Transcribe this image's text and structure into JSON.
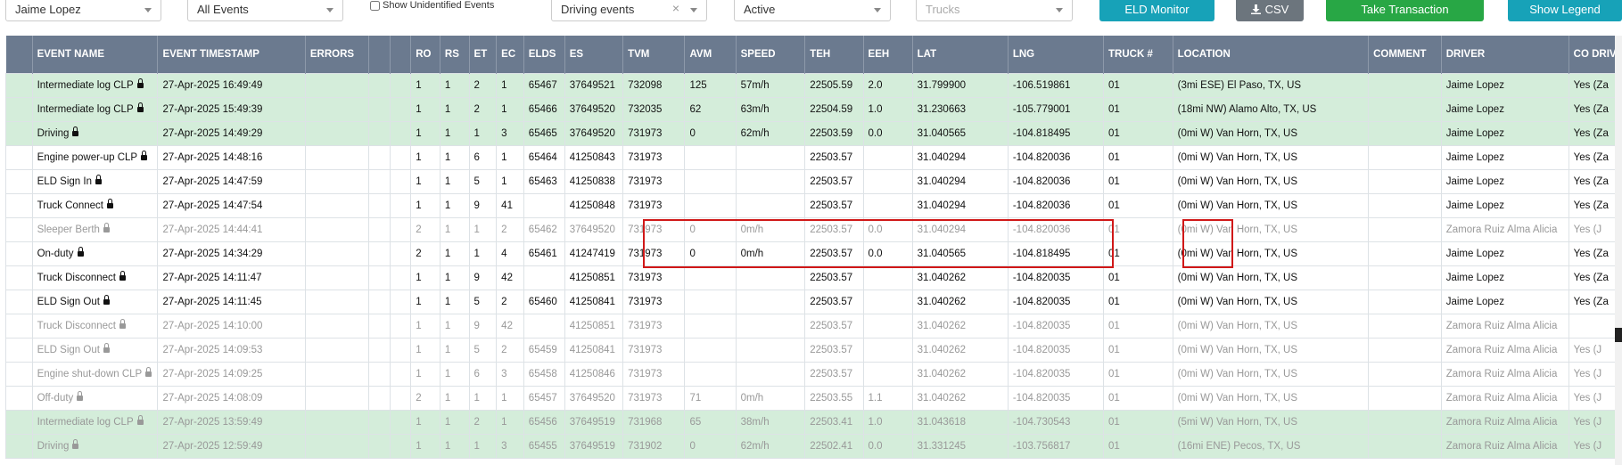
{
  "toolbar": {
    "driver_select": "Jaime Lopez",
    "events_select": "All Events",
    "show_unidentified_label": "Show Unidentified Events",
    "type_select": "Driving events",
    "type_clear": "×",
    "status_select": "Active",
    "trucks_placeholder": "Trucks",
    "eld_monitor": "ELD Monitor",
    "csv": "CSV",
    "csv_icon": "download-icon",
    "take_transaction": "Take Transaction",
    "show_legend": "Show Legend"
  },
  "colors": {
    "header": "#6b7a8f",
    "green_row": "#d4edda",
    "highlight": "#d01818",
    "btn_info": "#17a2b8",
    "btn_green": "#28a745",
    "btn_gray": "#6c757d"
  },
  "table": {
    "columns": [
      "",
      "EVENT NAME",
      "EVENT TIMESTAMP",
      "ERRORS",
      "",
      "",
      "RO",
      "RS",
      "ET",
      "EC",
      "ELDS",
      "ES",
      "TVM",
      "AVM",
      "SPEED",
      "TEH",
      "EEH",
      "LAT",
      "LNG",
      "TRUCK #",
      "LOCATION",
      "COMMENT",
      "DRIVER",
      "CO DRIV"
    ],
    "rows": [
      {
        "style": "green",
        "cells": [
          "",
          "Intermediate log CLP",
          "27-Apr-2025 16:49:49",
          "",
          "",
          "",
          "1",
          "1",
          "2",
          "1",
          "65467",
          "37649521",
          "732098",
          "125",
          "57m/h",
          "22505.59",
          "2.0",
          "31.799900",
          "-106.519861",
          "01",
          "(3mi ESE) El Paso, TX, US",
          "",
          "Jaime Lopez",
          "Yes (Za"
        ]
      },
      {
        "style": "green",
        "cells": [
          "",
          "Intermediate log CLP",
          "27-Apr-2025 15:49:39",
          "",
          "",
          "",
          "1",
          "1",
          "2",
          "1",
          "65466",
          "37649520",
          "732035",
          "62",
          "63m/h",
          "22504.59",
          "1.0",
          "31.230663",
          "-105.779001",
          "01",
          "(18mi NW) Alamo Alto, TX, US",
          "",
          "Jaime Lopez",
          "Yes (Za"
        ]
      },
      {
        "style": "green",
        "cells": [
          "",
          "Driving",
          "27-Apr-2025 14:49:29",
          "",
          "",
          "",
          "1",
          "1",
          "1",
          "3",
          "65465",
          "37649520",
          "731973",
          "0",
          "62m/h",
          "22503.59",
          "0.0",
          "31.040565",
          "-104.818495",
          "01",
          "(0mi W) Van Horn, TX, US",
          "",
          "Jaime Lopez",
          "Yes (Za"
        ]
      },
      {
        "style": "normal",
        "cells": [
          "",
          "Engine power-up CLP",
          "27-Apr-2025 14:48:16",
          "",
          "",
          "",
          "1",
          "1",
          "6",
          "1",
          "65464",
          "41250843",
          "731973",
          "",
          "",
          "22503.57",
          "",
          "31.040294",
          "-104.820036",
          "01",
          "(0mi W) Van Horn, TX, US",
          "",
          "Jaime Lopez",
          "Yes (Za"
        ]
      },
      {
        "style": "normal",
        "cells": [
          "",
          "ELD Sign In",
          "27-Apr-2025 14:47:59",
          "",
          "",
          "",
          "1",
          "1",
          "5",
          "1",
          "65463",
          "41250838",
          "731973",
          "",
          "",
          "22503.57",
          "",
          "31.040294",
          "-104.820036",
          "01",
          "(0mi W) Van Horn, TX, US",
          "",
          "Jaime Lopez",
          "Yes (Za"
        ]
      },
      {
        "style": "normal",
        "cells": [
          "",
          "Truck Connect",
          "27-Apr-2025 14:47:54",
          "",
          "",
          "",
          "1",
          "1",
          "9",
          "41",
          "",
          "41250848",
          "731973",
          "",
          "",
          "22503.57",
          "",
          "31.040294",
          "-104.820036",
          "01",
          "(0mi W) Van Horn, TX, US",
          "",
          "Jaime Lopez",
          "Yes (Za"
        ]
      },
      {
        "style": "faded",
        "cells": [
          "",
          "Sleeper Berth",
          "27-Apr-2025 14:44:41",
          "",
          "",
          "",
          "2",
          "1",
          "1",
          "2",
          "65462",
          "37649520",
          "731973",
          "0",
          "0m/h",
          "22503.57",
          "0.0",
          "31.040294",
          "-104.820036",
          "01",
          "(0mi W) Van Horn, TX, US",
          "",
          "Zamora Ruiz Alma Alicia",
          "Yes (J"
        ]
      },
      {
        "style": "normal",
        "cells": [
          "",
          "On-duty",
          "27-Apr-2025 14:34:29",
          "",
          "",
          "",
          "2",
          "1",
          "1",
          "4",
          "65461",
          "41247419",
          "731973",
          "0",
          "0m/h",
          "22503.57",
          "0.0",
          "31.040565",
          "-104.818495",
          "01",
          "(0mi W) Van Horn, TX, US",
          "",
          "Jaime Lopez",
          "Yes (Za"
        ]
      },
      {
        "style": "normal",
        "cells": [
          "",
          "Truck Disconnect",
          "27-Apr-2025 14:11:47",
          "",
          "",
          "",
          "1",
          "1",
          "9",
          "42",
          "",
          "41250851",
          "731973",
          "",
          "",
          "22503.57",
          "",
          "31.040262",
          "-104.820035",
          "01",
          "(0mi W) Van Horn, TX, US",
          "",
          "Jaime Lopez",
          "Yes (Za"
        ]
      },
      {
        "style": "normal",
        "cells": [
          "",
          "ELD Sign Out",
          "27-Apr-2025 14:11:45",
          "",
          "",
          "",
          "1",
          "1",
          "5",
          "2",
          "65460",
          "41250841",
          "731973",
          "",
          "",
          "22503.57",
          "",
          "31.040262",
          "-104.820035",
          "01",
          "(0mi W) Van Horn, TX, US",
          "",
          "Jaime Lopez",
          "Yes (Za"
        ]
      },
      {
        "style": "faded",
        "cells": [
          "",
          "Truck Disconnect",
          "27-Apr-2025 14:10:00",
          "",
          "",
          "",
          "1",
          "1",
          "9",
          "42",
          "",
          "41250851",
          "731973",
          "",
          "",
          "22503.57",
          "",
          "31.040262",
          "-104.820035",
          "01",
          "(0mi W) Van Horn, TX, US",
          "",
          "Zamora Ruiz Alma Alicia",
          ""
        ]
      },
      {
        "style": "faded",
        "cells": [
          "",
          "ELD Sign Out",
          "27-Apr-2025 14:09:53",
          "",
          "",
          "",
          "1",
          "1",
          "5",
          "2",
          "65459",
          "41250841",
          "731973",
          "",
          "",
          "22503.57",
          "",
          "31.040262",
          "-104.820035",
          "01",
          "(0mi W) Van Horn, TX, US",
          "",
          "Zamora Ruiz Alma Alicia",
          "Yes (J"
        ]
      },
      {
        "style": "faded",
        "cells": [
          "",
          "Engine shut-down CLP",
          "27-Apr-2025 14:09:25",
          "",
          "",
          "",
          "1",
          "1",
          "6",
          "3",
          "65458",
          "41250846",
          "731973",
          "",
          "",
          "22503.57",
          "",
          "31.040262",
          "-104.820035",
          "01",
          "(0mi W) Van Horn, TX, US",
          "",
          "Zamora Ruiz Alma Alicia",
          "Yes (J"
        ]
      },
      {
        "style": "faded",
        "cells": [
          "",
          "Off-duty",
          "27-Apr-2025 14:08:09",
          "",
          "",
          "",
          "2",
          "1",
          "1",
          "1",
          "65457",
          "37649520",
          "731973",
          "71",
          "0m/h",
          "22503.55",
          "1.1",
          "31.040262",
          "-104.820035",
          "01",
          "(0mi W) Van Horn, TX, US",
          "",
          "Zamora Ruiz Alma Alicia",
          "Yes (J"
        ]
      },
      {
        "style": "green faded",
        "cells": [
          "",
          "Intermediate log CLP",
          "27-Apr-2025 13:59:49",
          "",
          "",
          "",
          "1",
          "1",
          "2",
          "1",
          "65456",
          "37649519",
          "731968",
          "65",
          "38m/h",
          "22503.41",
          "1.0",
          "31.043618",
          "-104.730543",
          "01",
          "(5mi W) Van Horn, TX, US",
          "",
          "Zamora Ruiz Alma Alicia",
          "Yes (J"
        ]
      },
      {
        "style": "green faded",
        "cells": [
          "",
          "Driving",
          "27-Apr-2025 12:59:49",
          "",
          "",
          "",
          "1",
          "1",
          "1",
          "3",
          "65455",
          "37649519",
          "731902",
          "0",
          "62m/h",
          "22502.41",
          "0.0",
          "31.331245",
          "-103.756817",
          "01",
          "(16mi ENE) Pecos, TX, US",
          "",
          "Zamora Ruiz Alma Alicia",
          "Yes (J"
        ]
      }
    ]
  }
}
